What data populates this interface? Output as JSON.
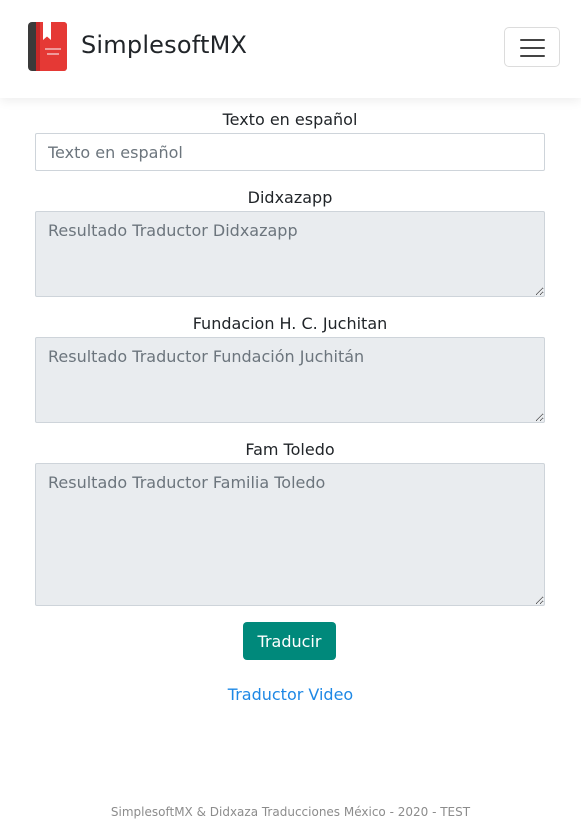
{
  "header": {
    "brand_name": "SimplesoftMX",
    "logo_icon": "book-icon",
    "menu_icon": "hamburger-menu-icon"
  },
  "form": {
    "spanish": {
      "label": "Texto en español",
      "placeholder": "Texto en español",
      "value": ""
    },
    "didxazapp": {
      "label": "Didxazapp",
      "placeholder": "Resultado Traductor Didxazapp"
    },
    "fundacion": {
      "label": "Fundacion H. C. Juchitan",
      "placeholder": "Resultado Traductor Fundación Juchitán"
    },
    "toledo": {
      "label": "Fam Toledo",
      "placeholder": "Resultado Traductor Familia Toledo"
    },
    "translate_button": "Traducir",
    "video_link": "Traductor Video"
  },
  "footer": {
    "text": "SimplesoftMX & Didxaza Traducciones México - 2020 - TEST"
  },
  "colors": {
    "primary_button": "#00897b",
    "link": "#1e88e5",
    "readonly_bg": "#e9ecef"
  }
}
